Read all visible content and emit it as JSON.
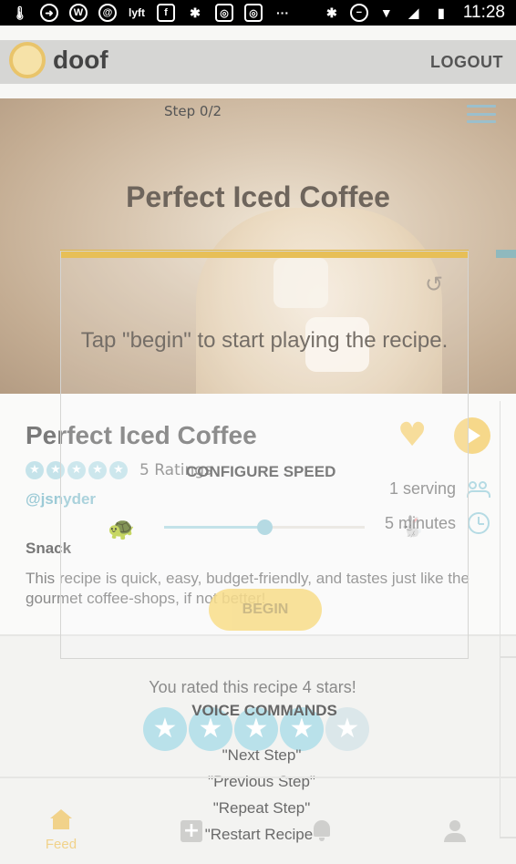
{
  "status_bar": {
    "time": "11:28",
    "icons": [
      "thermometer-icon",
      "circle-arrow-icon",
      "w-app-icon",
      "chat-app-icon",
      "lyft-icon",
      "facebook-icon",
      "yelp-icon",
      "instagram-icon",
      "instagram-icon",
      "more-icon",
      "bluetooth-icon",
      "dnd-icon",
      "wifi-icon",
      "signal-icon",
      "battery-icon"
    ],
    "more": "···"
  },
  "header": {
    "logo_text": "doof",
    "logout_label": "LOGOUT",
    "logo_color": "#e9c46a"
  },
  "player": {
    "step_label": "Step 0/2",
    "title": "Perfect Iced Coffee",
    "instruction": "Tap \"begin\" to start playing the recipe.",
    "progress": 0.0,
    "accent_color": "#e3b43a",
    "refresh_glyph": "↺"
  },
  "recipe": {
    "title": "Perfect Iced Coffee",
    "stars_glyph": "★",
    "star_rating": 5,
    "ratings_text": "5 Ratings",
    "author": "@jsnyder",
    "servings": "1 serving",
    "time": "5 minutes",
    "category": "Snack",
    "description": "This recipe is quick, easy, budget-friendly, and tastes just like the gourmet coffee-shops, if not better!",
    "heart_glyph": "♥"
  },
  "speed": {
    "title": "CONFIGURE SPEED",
    "value": 0.5,
    "slow_icon": "turtle-icon",
    "fast_icon": "rabbit-icon"
  },
  "begin_label": "BEGIN",
  "user_rating": {
    "text": "You rated this recipe 4 stars!",
    "value": 4,
    "max": 5,
    "star_glyph": "★"
  },
  "voice": {
    "title": "VOICE COMMANDS",
    "commands": [
      "\"Next Step\"",
      "\"Previous Step\"",
      "\"Repeat Step\"",
      "\"Restart Recipe\""
    ]
  },
  "nav": {
    "feed_label": "Feed",
    "add_glyph": "+",
    "active_color": "#f1d28a"
  }
}
